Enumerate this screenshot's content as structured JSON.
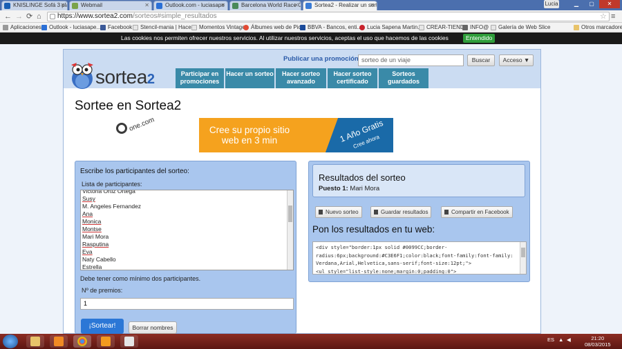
{
  "browser": {
    "tabs": [
      {
        "label": "KNISLINGE Sofá 3 plazas"
      },
      {
        "label": "Webmail"
      },
      {
        "label": "Outlook.com - luciasape"
      },
      {
        "label": "Barcelona World Race Ga"
      },
      {
        "label": "Sortea2 - Realizar un sorte",
        "active": true
      }
    ],
    "user": "Lucia",
    "url_host": "https://www.sortea2.com",
    "url_path": "/sorteos#simple_resultados",
    "bookmarks": [
      "Aplicaciones",
      "Outlook - luciasape...",
      "Facebook",
      "Stencil-mania | Hace...",
      "Momentos Vintage",
      "Álbumes web de Pic...",
      "BBVA - Bancos, enti...",
      "Lucia Sapena Martin...",
      "CREAR-TIENDA",
      "INFO@",
      "Galería de Web Slice",
      "Otros marcadores"
    ]
  },
  "cookie": {
    "text": "Las cookies nos permiten ofrecer nuestros servicios. Al utilizar nuestros servicios, aceptas el uso que hacemos de las cookies",
    "accept": "Entendido"
  },
  "header": {
    "logo_text": "sortea",
    "logo_num": "2",
    "publicar": "Publicar una promoción",
    "search_placeholder": "sorteo de un viaje",
    "buscar": "Buscar",
    "acceso": "Acceso ▼",
    "nav": [
      {
        "label": "Participar en promociones"
      },
      {
        "label": "Hacer un sorteo"
      },
      {
        "label": "Hacer sorteo avanzado"
      },
      {
        "label": "Hacer sorteo certificado"
      },
      {
        "label": "Sorteos guardados"
      }
    ]
  },
  "page_title": "Sortee en Sortea2",
  "ad": {
    "brand": "one.com",
    "headline": "Cree su propio sitio web en 3 min",
    "offer": "1 Año Gratis",
    "cta": "Cree ahora"
  },
  "left": {
    "title": "Escribe los participantes del sorteo:",
    "list_label": "Lista de participantes:",
    "participants": [
      "Victoria Ortiz Ortega",
      "Susy",
      "M. Angeles Fernandez",
      "Ana",
      "Monica",
      "Montse",
      "Mari Mora",
      "Rasputina",
      "Eva",
      "Naty Cabello",
      "Estrella"
    ],
    "min_text": "Debe tener como mínimo dos participantes.",
    "premios_label": "Nº de premios:",
    "premios_value": "1",
    "sortear": "¡Sortear!",
    "borrar": "Borrar nombres"
  },
  "right": {
    "title": "Resultados del sorteo",
    "puesto_label": "Puesto 1:",
    "puesto_value": "Mari Mora",
    "btn_nuevo": "Nuevo sorteo",
    "btn_guardar": "Guardar resultados",
    "btn_compartir": "Compartir en Facebook",
    "pon_title": "Pon los resultados en tu web:",
    "code": "<div style=\"border:1px solid #0099CC;border-radius:6px;background:#C3E6F1;color:black;font-family:font-family: Verdana,Arial,Helvetica,sans-serif;font-size:12pt;\">\n<ul style=\"list-style:none;margin:0;padding:0\">"
  },
  "taskbar": {
    "lang": "ES",
    "time": "21:20",
    "date": "08/03/2015"
  }
}
